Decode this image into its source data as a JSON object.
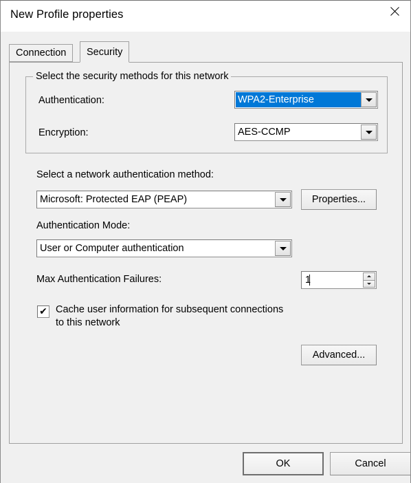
{
  "window": {
    "title": "New Profile properties",
    "close_icon": "close-icon"
  },
  "tabs": [
    {
      "label": "Connection",
      "active": false
    },
    {
      "label": "Security",
      "active": true
    }
  ],
  "security_group": {
    "legend": "Select the security methods for this network",
    "authentication": {
      "label": "Authentication:",
      "value": "WPA2-Enterprise",
      "highlighted": true,
      "highlight_color": "#0078d7"
    },
    "encryption": {
      "label": "Encryption:",
      "value": "AES-CCMP",
      "highlighted": false
    }
  },
  "eap_method": {
    "label": "Select a network authentication method:",
    "value": "Microsoft: Protected EAP (PEAP)",
    "properties_button": "Properties..."
  },
  "auth_mode": {
    "label": "Authentication Mode:",
    "value": "User or Computer authentication"
  },
  "max_failures": {
    "label": "Max Authentication Failures:",
    "value": "1"
  },
  "cache_checkbox": {
    "checked": true,
    "check_glyph": "✔",
    "line1": "Cache user information for subsequent connections",
    "line2": "to this network"
  },
  "advanced_button": {
    "label": "Advanced..."
  },
  "dialog_buttons": {
    "ok": "OK",
    "cancel": "Cancel"
  }
}
